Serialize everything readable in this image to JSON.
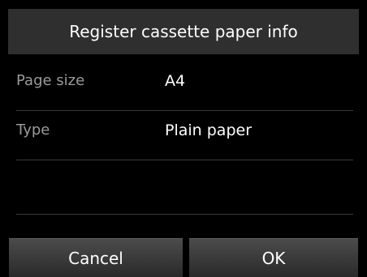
{
  "header": {
    "title": "Register cassette paper info"
  },
  "settings": [
    {
      "label": "Page size",
      "value": "A4"
    },
    {
      "label": "Type",
      "value": "Plain paper"
    }
  ],
  "buttons": {
    "cancel_label": "Cancel",
    "ok_label": "OK"
  }
}
